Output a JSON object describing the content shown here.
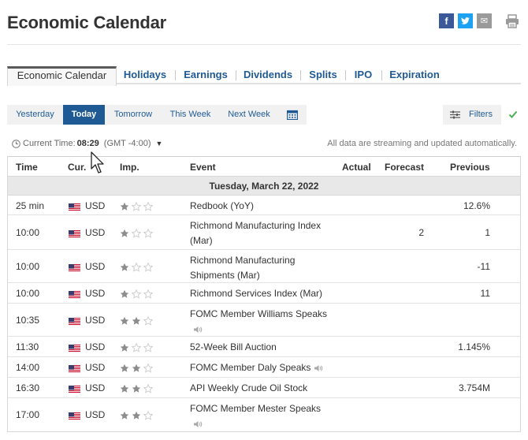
{
  "header": {
    "title": "Economic Calendar",
    "share": {
      "facebook": "f",
      "twitter": "t",
      "mail": "✉"
    }
  },
  "tabs": [
    {
      "label": "Economic Calendar"
    },
    {
      "label": "Holidays"
    },
    {
      "label": "Earnings"
    },
    {
      "label": "Dividends"
    },
    {
      "label": "Splits"
    },
    {
      "label": "IPO"
    },
    {
      "label": "Expiration"
    }
  ],
  "date_filters": [
    {
      "label": "Yesterday"
    },
    {
      "label": "Today"
    },
    {
      "label": "Tomorrow"
    },
    {
      "label": "This Week"
    },
    {
      "label": "Next Week"
    }
  ],
  "filters_label": "Filters",
  "current_time": {
    "label": "Current Time:",
    "value": "08:29",
    "timezone": "(GMT -4:00)"
  },
  "streaming_note": "All data are streaming and updated automatically.",
  "table": {
    "headers": {
      "time": "Time",
      "currency": "Cur.",
      "importance": "Imp.",
      "event": "Event",
      "actual": "Actual",
      "forecast": "Forecast",
      "previous": "Previous"
    },
    "date": "Tuesday, March 22, 2022",
    "rows": [
      {
        "time": "25 min",
        "currency": "USD",
        "importance": 1,
        "event": "Redbook (YoY)",
        "speech": false,
        "forecast": "",
        "previous": "12.6%"
      },
      {
        "time": "10:00",
        "currency": "USD",
        "importance": 1,
        "event": "Richmond Manufacturing Index (Mar)",
        "speech": false,
        "forecast": "2",
        "previous": "1"
      },
      {
        "time": "10:00",
        "currency": "USD",
        "importance": 1,
        "event": "Richmond Manufacturing Shipments (Mar)",
        "speech": false,
        "forecast": "",
        "previous": "-11"
      },
      {
        "time": "10:00",
        "currency": "USD",
        "importance": 1,
        "event": "Richmond Services Index (Mar)",
        "speech": false,
        "forecast": "",
        "previous": "11"
      },
      {
        "time": "10:35",
        "currency": "USD",
        "importance": 2,
        "event": "FOMC Member Williams Speaks",
        "speech": true,
        "forecast": "",
        "previous": ""
      },
      {
        "time": "11:30",
        "currency": "USD",
        "importance": 1,
        "event": "52-Week Bill Auction",
        "speech": false,
        "forecast": "",
        "previous": "1.145%"
      },
      {
        "time": "14:00",
        "currency": "USD",
        "importance": 2,
        "event": "FOMC Member Daly Speaks",
        "speech": true,
        "forecast": "",
        "previous": ""
      },
      {
        "time": "16:30",
        "currency": "USD",
        "importance": 2,
        "event": "API Weekly Crude Oil Stock",
        "speech": false,
        "forecast": "",
        "previous": "3.754M"
      },
      {
        "time": "17:00",
        "currency": "USD",
        "importance": 2,
        "event": "FOMC Member Mester Speaks",
        "speech": true,
        "forecast": "",
        "previous": ""
      }
    ]
  },
  "colors": {
    "link": "#1f5a94",
    "star_filled": "#8c8c8c",
    "star_empty": "#cfcfcf"
  }
}
